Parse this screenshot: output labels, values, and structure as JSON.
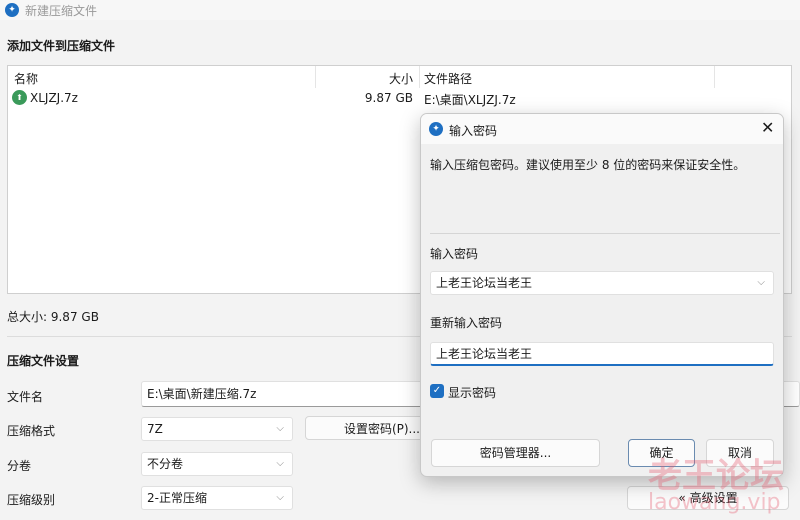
{
  "window": {
    "title": "新建压缩文件",
    "icon": "app-logo-icon"
  },
  "add_section": {
    "title": "添加文件到压缩文件",
    "columns": [
      "名称",
      "大小",
      "文件路径"
    ],
    "rows": [
      {
        "name": "XLJZJ.7z",
        "size": "9.87 GB",
        "path": "E:\\桌面\\XLJZJ.7z",
        "icon": "7z-archive-icon"
      }
    ]
  },
  "total_size": "总大小: 9.87 GB",
  "settings": {
    "title": "压缩文件设置",
    "filename_label": "文件名",
    "filename_value": "E:\\桌面\\新建压缩.7z",
    "format_label": "压缩格式",
    "format_value": "7Z",
    "set_password_button": "设置密码(P)...",
    "split_label": "分卷",
    "split_value": "不分卷",
    "level_label": "压缩级别",
    "level_value": "2-正常压缩",
    "advanced_button": "« 高级设置"
  },
  "dialog": {
    "title": "输入密码",
    "description": "输入压缩包密码。建议使用至少 8 位的密码来保证安全性。",
    "password_label": "输入密码",
    "password_value": "上老王论坛当老王",
    "confirm_label": "重新输入密码",
    "confirm_value": "上老王论坛当老王",
    "show_password_label": "显示密码",
    "show_password_checked": true,
    "manager_button": "密码管理器...",
    "ok_button": "确定",
    "cancel_button": "取消"
  },
  "watermark": {
    "line1": "老王论坛",
    "line2": "laowang.vip"
  },
  "colors": {
    "accent": "#1e6fc2"
  }
}
